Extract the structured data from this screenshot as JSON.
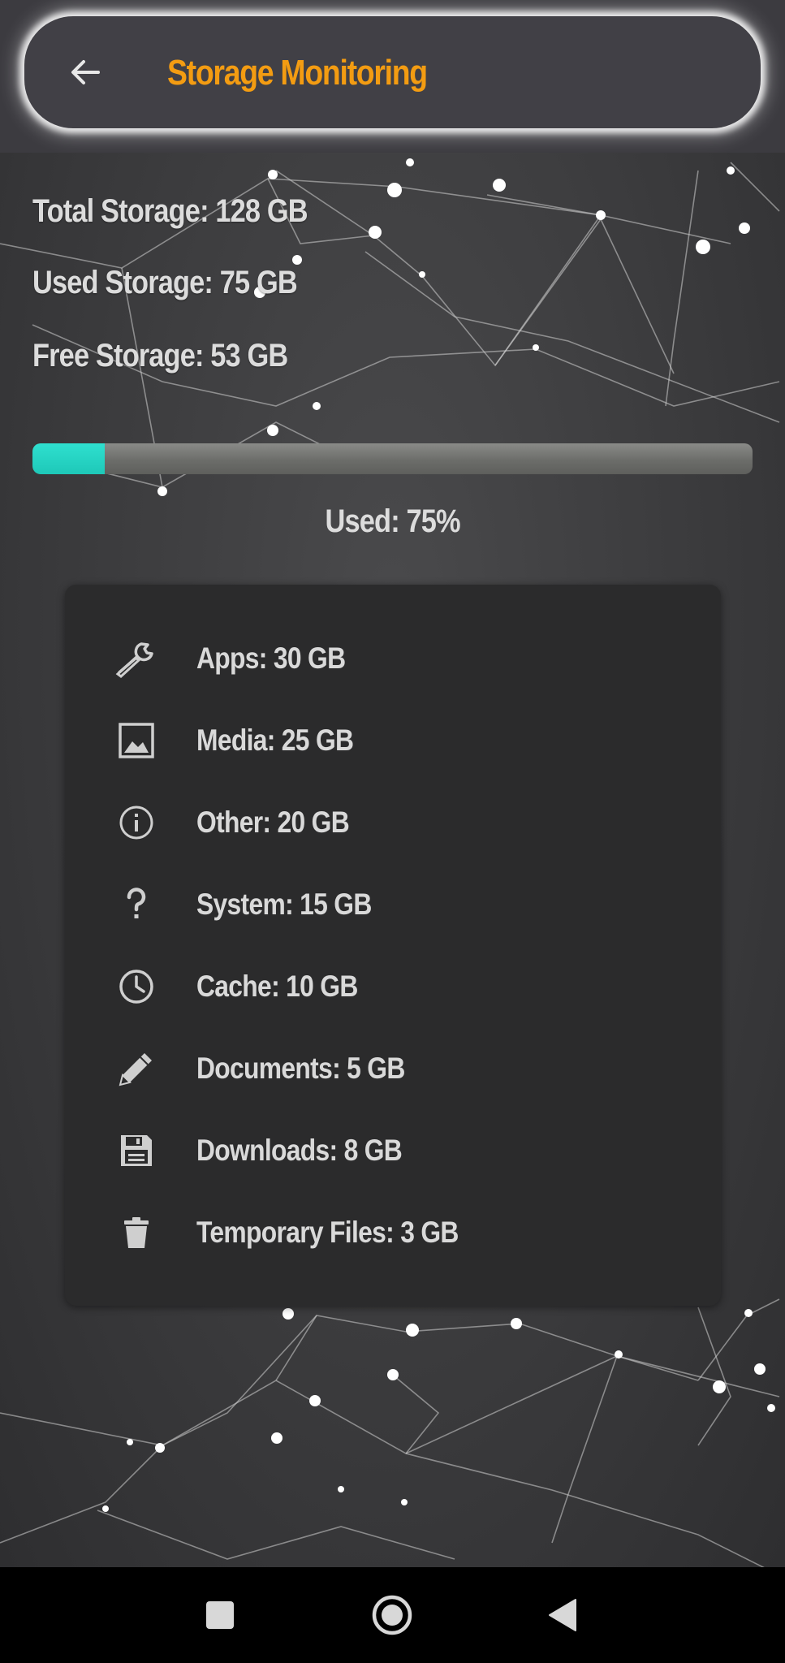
{
  "app_bar": {
    "title": "Storage Monitoring",
    "back_icon": "arrow-left-icon",
    "title_color": "#f39c12"
  },
  "storage": {
    "total": "Total Storage: 128 GB",
    "used": "Used Storage: 75 GB",
    "free": "Free Storage: 53 GB",
    "used_percent_label": "Used: 75%",
    "progress_fill_percent": 10,
    "progress_color": "#1ec8b8"
  },
  "categories": [
    {
      "icon": "wrench-icon",
      "label": "Apps: 30 GB"
    },
    {
      "icon": "image-icon",
      "label": "Media: 25 GB"
    },
    {
      "icon": "info-icon",
      "label": "Other: 20 GB"
    },
    {
      "icon": "question-icon",
      "label": "System: 15 GB"
    },
    {
      "icon": "clock-icon",
      "label": "Cache: 10 GB"
    },
    {
      "icon": "pencil-icon",
      "label": "Documents: 5 GB"
    },
    {
      "icon": "floppy-disk-icon",
      "label": "Downloads: 8 GB"
    },
    {
      "icon": "trash-icon",
      "label": "Temporary Files: 3 GB"
    }
  ],
  "nav_bar": {
    "recents_icon": "square-icon",
    "home_icon": "circle-home-icon",
    "back_icon": "triangle-back-icon"
  }
}
